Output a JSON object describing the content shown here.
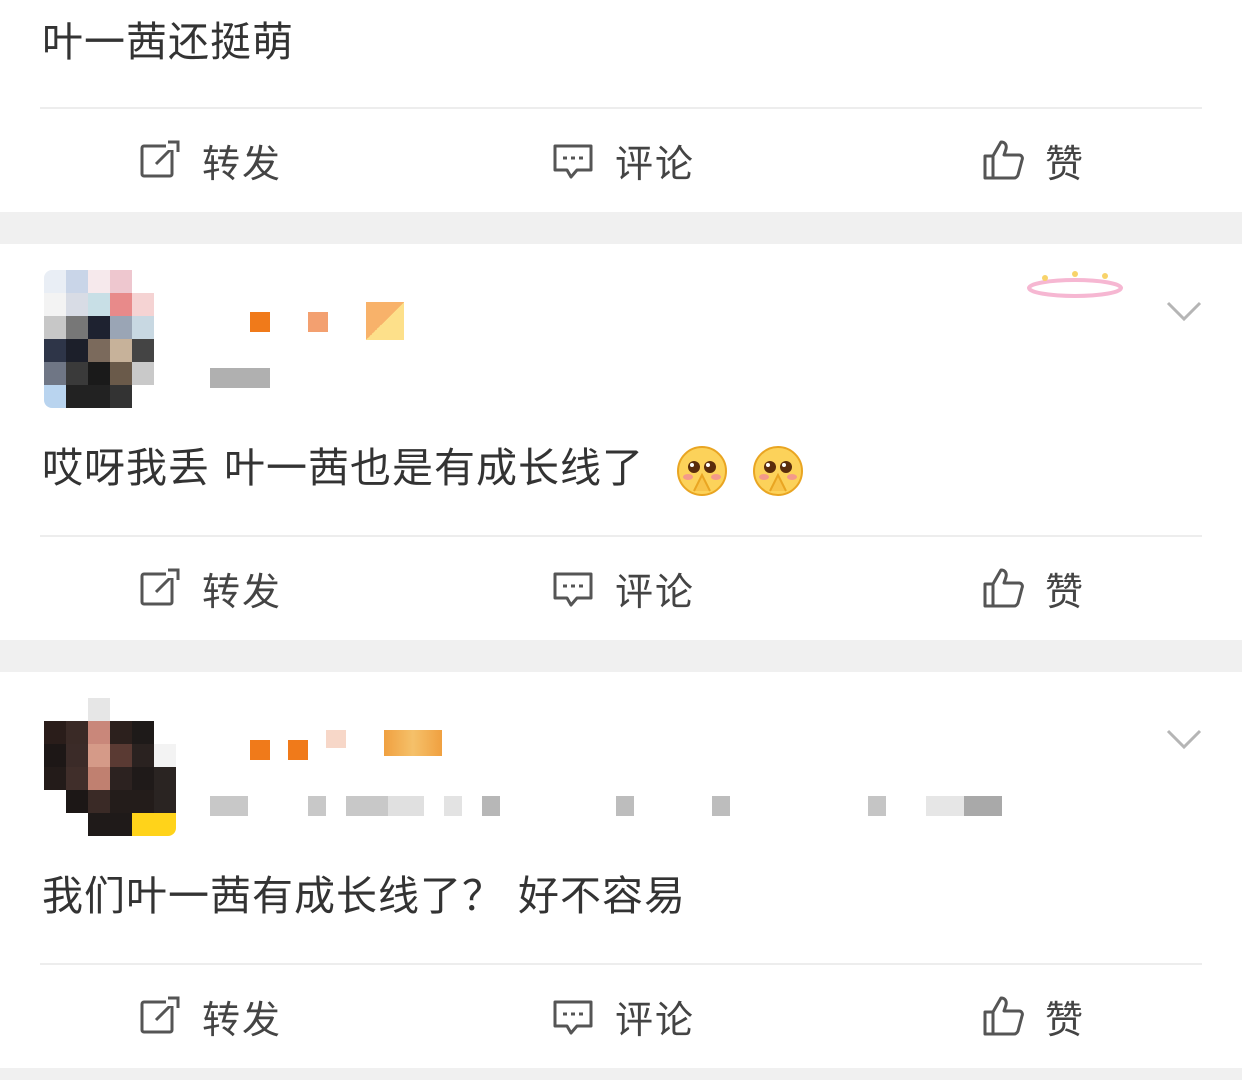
{
  "posts": [
    {
      "text": "叶一茜还挺萌",
      "actions": {
        "repost": "转发",
        "comment": "评论",
        "like": "赞"
      }
    },
    {
      "text": "哎呀我丢  叶一茜也是有成长线了",
      "emojis": [
        "pleading-face-icon",
        "pleading-face-icon"
      ],
      "actions": {
        "repost": "转发",
        "comment": "评论",
        "like": "赞"
      }
    },
    {
      "text": "我们叶一茜有成长线了？  好不容易",
      "actions": {
        "repost": "转发",
        "comment": "评论",
        "like": "赞"
      }
    }
  ],
  "colors": {
    "accent_orange": "#f07a1a",
    "icon_gray": "#555555",
    "separator": "#f0f0f0"
  }
}
